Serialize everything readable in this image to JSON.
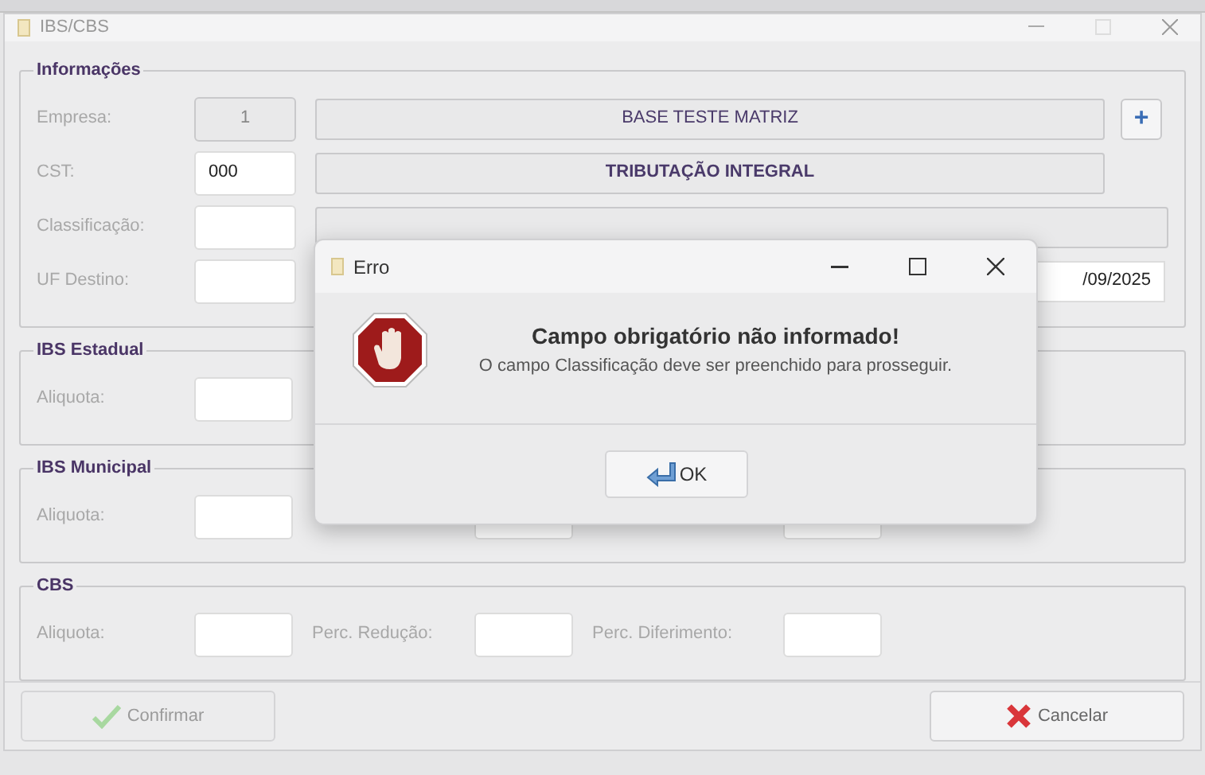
{
  "window": {
    "title": "IBS/CBS"
  },
  "informacoes": {
    "legend": "Informações",
    "rows": [
      {
        "label": "Empresa:",
        "code": "1",
        "code_disabled": true,
        "description": "BASE TESTE MATRIZ",
        "description_bold": false,
        "action": "+"
      },
      {
        "label": "CST:",
        "code": "000",
        "code_disabled": false,
        "description": "TRIBUTAÇÃO INTEGRAL",
        "description_bold": true
      },
      {
        "label": "Classificação:",
        "code_disabled": false
      },
      {
        "label": "UF Destino:",
        "code_disabled": false,
        "date": "/09/2025"
      }
    ]
  },
  "groups": [
    {
      "legend": "IBS Estadual",
      "fields": [
        {
          "kind": "labeled",
          "label": "Aliquota:"
        }
      ]
    },
    {
      "legend": "IBS Municipal",
      "fields": [
        {
          "kind": "labeled",
          "label": "Aliquota:"
        },
        {
          "kind": "unlabeled"
        },
        {
          "kind": "unlabeled"
        }
      ]
    },
    {
      "legend": "CBS",
      "fields": [
        {
          "kind": "labeled",
          "label": "Aliquota:"
        },
        {
          "kind": "labeled",
          "label": "Perc. Redução:"
        },
        {
          "kind": "labeled",
          "label": "Perc. Diferimento:"
        }
      ]
    }
  ],
  "buttons": [
    {
      "label": "Confirmar",
      "kind": "confirm",
      "disabled": true
    },
    {
      "label": "Cancelar",
      "kind": "cancel",
      "disabled": false
    }
  ],
  "dialog": {
    "title": "Erro",
    "heading": "Campo obrigatório não informado!",
    "message": "O campo Classificação deve ser preenchido para prosseguir.",
    "button": "OK"
  }
}
